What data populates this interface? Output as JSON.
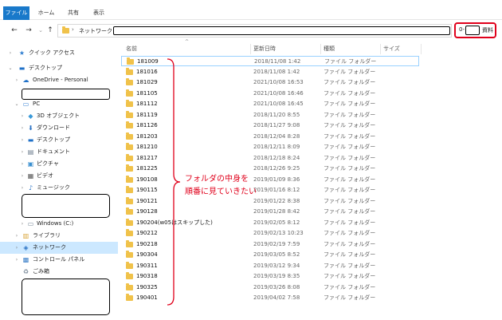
{
  "ribbon": {
    "tabs": [
      {
        "label": "ファイル",
        "active": true
      },
      {
        "label": "ホーム",
        "active": false
      },
      {
        "label": "共有",
        "active": false
      },
      {
        "label": "表示",
        "active": false
      }
    ]
  },
  "address": {
    "back_icon": "arrow-left-icon",
    "forward_icon": "arrow-right-icon",
    "recent_icon": "chevron-down-icon",
    "up_icon": "arrow-up-icon",
    "separator": "›",
    "location": "ネットワーク",
    "path_separator": "›"
  },
  "search": {
    "prefix": "0-",
    "suffix": "資料"
  },
  "sidebar": {
    "items": [
      {
        "label": "クイック アクセス",
        "icon": "star-icon",
        "icon_color": "#2f7fd0"
      },
      {
        "label": "デスクトップ",
        "icon": "desktop-icon",
        "icon_color": "#1e70c8"
      },
      {
        "label": "OneDrive - Personal",
        "icon": "cloud-icon",
        "icon_color": "#1e70c8"
      },
      {
        "label": "PC",
        "icon": "pc-icon",
        "icon_color": "#3b86d6"
      },
      {
        "label": "3D オブジェクト",
        "icon": "cube-icon",
        "icon_color": "#3a9ad9"
      },
      {
        "label": "ダウンロード",
        "icon": "download-icon",
        "icon_color": "#2c73c4"
      },
      {
        "label": "デスクトップ",
        "icon": "desktop-icon",
        "icon_color": "#1e70c8"
      },
      {
        "label": "ドキュメント",
        "icon": "document-icon",
        "icon_color": "#6b7b8c"
      },
      {
        "label": "ピクチャ",
        "icon": "picture-icon",
        "icon_color": "#3a8fd0"
      },
      {
        "label": "ビデオ",
        "icon": "video-icon",
        "icon_color": "#555"
      },
      {
        "label": "ミュージック",
        "icon": "music-icon",
        "icon_color": "#2c73c4"
      },
      {
        "label": "Windows (C:)",
        "icon": "drive-icon",
        "icon_color": "#7a8a99"
      },
      {
        "label": "ライブラリ",
        "icon": "library-icon",
        "icon_color": "#d9a53a"
      },
      {
        "label": "ネットワーク",
        "icon": "network-icon",
        "icon_color": "#2c73c4"
      },
      {
        "label": "コントロール パネル",
        "icon": "control-panel-icon",
        "icon_color": "#3a7fc8"
      },
      {
        "label": "ごみ箱",
        "icon": "recycle-bin-icon",
        "icon_color": "#7a8a99"
      }
    ]
  },
  "columns": {
    "name": "名前",
    "date": "更新日時",
    "type": "種類",
    "size": "サイズ"
  },
  "files": [
    {
      "name": "181009",
      "date": "2018/11/08 1:42",
      "type": "ファイル フォルダー"
    },
    {
      "name": "181016",
      "date": "2018/11/08 1:42",
      "type": "ファイル フォルダー"
    },
    {
      "name": "181029",
      "date": "2021/10/08 16:53",
      "type": "ファイル フォルダー"
    },
    {
      "name": "181105",
      "date": "2021/10/08 16:46",
      "type": "ファイル フォルダー"
    },
    {
      "name": "181112",
      "date": "2021/10/08 16:45",
      "type": "ファイル フォルダー"
    },
    {
      "name": "181119",
      "date": "2018/11/20 8:55",
      "type": "ファイル フォルダー"
    },
    {
      "name": "181126",
      "date": "2018/11/27 9:08",
      "type": "ファイル フォルダー"
    },
    {
      "name": "181203",
      "date": "2018/12/04 8:28",
      "type": "ファイル フォルダー"
    },
    {
      "name": "181210",
      "date": "2018/12/11 8:09",
      "type": "ファイル フォルダー"
    },
    {
      "name": "181217",
      "date": "2018/12/18 8:24",
      "type": "ファイル フォルダー"
    },
    {
      "name": "181225",
      "date": "2018/12/26 9:25",
      "type": "ファイル フォルダー"
    },
    {
      "name": "190108",
      "date": "2019/01/09 8:36",
      "type": "ファイル フォルダー"
    },
    {
      "name": "190115",
      "date": "2019/01/16 8:12",
      "type": "ファイル フォルダー"
    },
    {
      "name": "190121",
      "date": "2019/01/22 8:38",
      "type": "ファイル フォルダー"
    },
    {
      "name": "190128",
      "date": "2019/01/28 8:42",
      "type": "ファイル フォルダー"
    },
    {
      "name": "190204(w05はスキップした)",
      "date": "2019/02/05 8:12",
      "type": "ファイル フォルダー"
    },
    {
      "name": "190212",
      "date": "2019/02/13 10:23",
      "type": "ファイル フォルダー"
    },
    {
      "name": "190218",
      "date": "2019/02/19 7:59",
      "type": "ファイル フォルダー"
    },
    {
      "name": "190304",
      "date": "2019/03/05 8:52",
      "type": "ファイル フォルダー"
    },
    {
      "name": "190311",
      "date": "2019/03/12 9:34",
      "type": "ファイル フォルダー"
    },
    {
      "name": "190318",
      "date": "2019/03/19 8:35",
      "type": "ファイル フォルダー"
    },
    {
      "name": "190325",
      "date": "2019/03/26 8:08",
      "type": "ファイル フォルダー"
    },
    {
      "name": "190401",
      "date": "2019/04/02 7:58",
      "type": "ファイル フォルダー"
    }
  ],
  "annotation": {
    "line1": "フォルダの中身を",
    "line2": "順番に見ていきたい",
    "color": "#e0001b"
  }
}
